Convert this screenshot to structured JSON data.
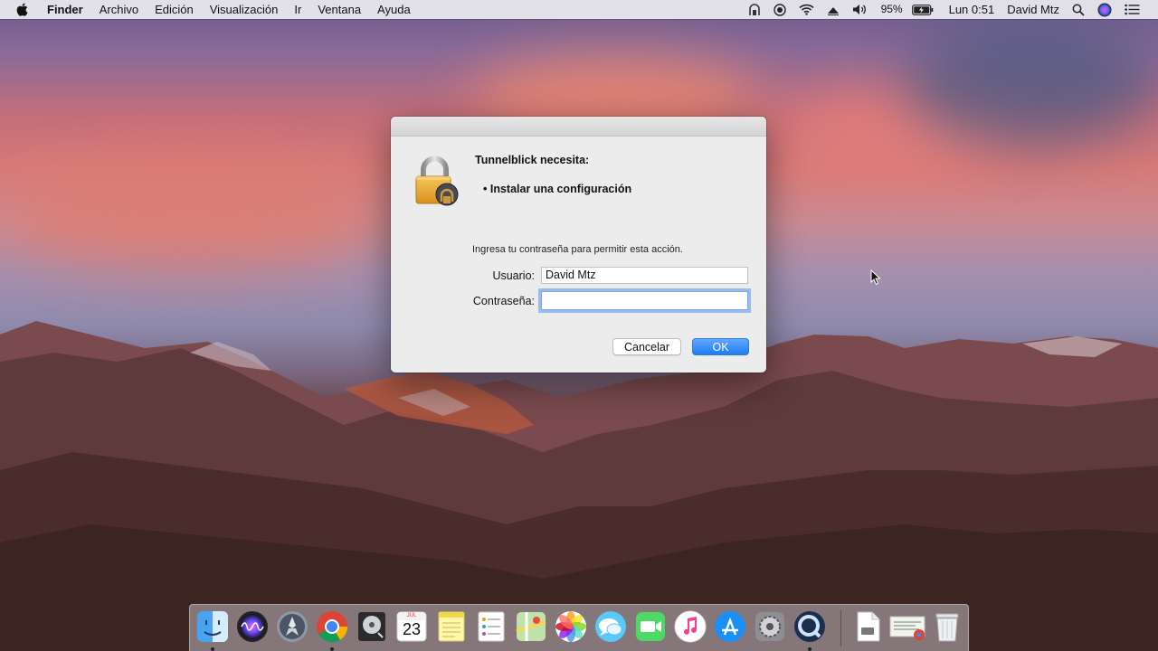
{
  "menubar": {
    "app_name": "Finder",
    "items": [
      "Archivo",
      "Edición",
      "Visualización",
      "Ir",
      "Ventana",
      "Ayuda"
    ],
    "status": {
      "battery_percent": "95%",
      "clock": "Lun 0:51",
      "user": "David Mtz",
      "icons": [
        "vpn-icon",
        "record-icon",
        "wifi-icon",
        "airplay-icon",
        "volume-icon",
        "battery-icon",
        "spotlight-icon",
        "siri-icon",
        "notification-center-icon"
      ]
    }
  },
  "dialog": {
    "heading": "Tunnelblick necesita:",
    "bullet": "• Instalar una configuración",
    "prompt": "Ingresa tu contraseña para permitir esta acción.",
    "user_label": "Usuario:",
    "user_value": "David Mtz",
    "password_label": "Contraseña:",
    "password_value": "",
    "cancel_label": "Cancelar",
    "ok_label": "OK"
  },
  "dock": {
    "apps": [
      "finder",
      "siri",
      "launchpad",
      "chrome",
      "disk-utility",
      "calendar",
      "notes",
      "reminders",
      "maps",
      "photos",
      "messages",
      "facetime",
      "itunes",
      "app-store",
      "system-preferences",
      "quicktime",
      "document",
      "chrome-download",
      "trash"
    ],
    "calendar_month": "JUL",
    "calendar_day": "23"
  },
  "colors": {
    "accent": "#1f7cf2",
    "focus_ring": "#5894eb"
  }
}
